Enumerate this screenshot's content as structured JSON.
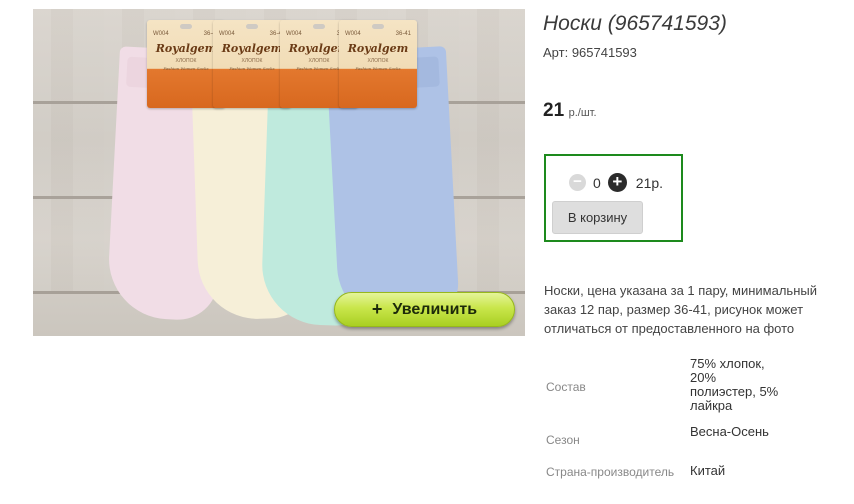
{
  "product": {
    "title": "Носки (965741593)",
    "sku_label": "Арт:",
    "sku_value": "965741593",
    "price": "21",
    "price_unit": "р./шт."
  },
  "image": {
    "zoom_label": "Увеличить",
    "zoom_icon": "plus-icon",
    "tags": [
      {
        "code": "W004",
        "size": "36-41",
        "brand": "Royalgem",
        "material": "ХЛОПОК",
        "desc": "Fashion Women Socks"
      },
      {
        "code": "W004",
        "size": "36-41",
        "brand": "Royalgem",
        "material": "ХЛОПОК",
        "desc": "Fashion Women Socks"
      },
      {
        "code": "W004",
        "size": "36-41",
        "brand": "Royalgem",
        "material": "ХЛОПОК",
        "desc": "Fashion Women Socks"
      },
      {
        "code": "W004",
        "size": "36-41",
        "brand": "Royalgem",
        "material": "ХЛОПОК",
        "desc": "Fashion Women Socks"
      }
    ],
    "sock_colors": [
      "#f1dde6",
      "#f6efd8",
      "#bfeadd",
      "#aec2e6"
    ]
  },
  "cart": {
    "minus_icon": "minus-circle-icon",
    "plus_icon": "plus-circle-icon",
    "quantity": "0",
    "line_total": "21р.",
    "add_button": "В корзину",
    "border_color": "#1d8a1d"
  },
  "description": "Носки, цена указана за 1 пару, минимальный заказ 12 пар, размер 36-41, рисунок может отличаться от предоставленного на фото",
  "properties": [
    {
      "key": "Состав",
      "value": "75% хлопок, 20% полиэстер, 5% лайкра"
    },
    {
      "key": "Сезон",
      "value": "Весна-Осень"
    },
    {
      "key": "Страна-производитель",
      "value": "Китай"
    }
  ]
}
